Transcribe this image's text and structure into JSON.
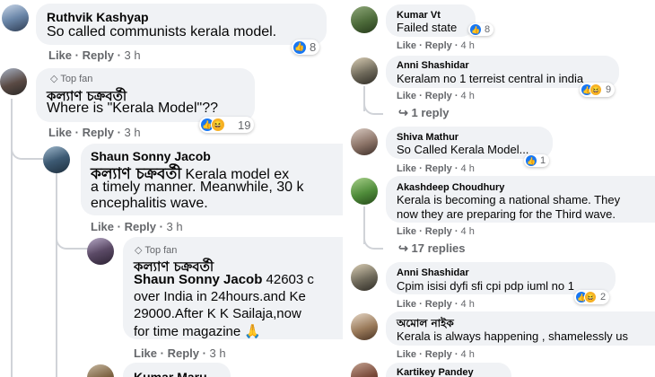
{
  "left": {
    "c1": {
      "name": "Ruthvik Kashyap",
      "text": "So called communists kerala model.",
      "like": "Like",
      "reply": "Reply",
      "time": "3 h",
      "count": "8"
    },
    "c2": {
      "badge": "Top fan",
      "name": "কল্যাণ চক্রবর্তী",
      "text": "Where is \"Kerala Model\"??",
      "like": "Like",
      "reply": "Reply",
      "time": "3 h",
      "count": "19"
    },
    "c3": {
      "name": "Shaun Sonny Jacob",
      "mention": "কল্যাণ চক্রবর্তী",
      "line1": "Kerala model ex",
      "line2": "a timely manner. Meanwhile, 30 k",
      "line3": "encephalitis wave.",
      "like": "Like",
      "reply": "Reply",
      "time": "3 h"
    },
    "c4": {
      "badge": "Top fan",
      "name": "কল্যাণ চক্রবর্তী",
      "mention": "Shaun Sonny Jacob",
      "line1": "42603 c",
      "line2": "over India in 24hours.and Ke",
      "line3": "29000.After K K Sailaja,now",
      "line4": "for time magazine",
      "like": "Like",
      "reply": "Reply",
      "time": "3 h"
    },
    "c5": {
      "name": "Kumar Maru"
    }
  },
  "right": {
    "c1": {
      "name": "Kumar Vt",
      "text": "Failed state",
      "like": "Like",
      "reply": "Reply",
      "time": "4 h",
      "count": "8"
    },
    "c2": {
      "name": "Anni Shashidar",
      "text": "Keralam no 1 terreist central in india",
      "like": "Like",
      "reply": "Reply",
      "time": "4 h",
      "count": "9",
      "replies": "1 reply"
    },
    "c3": {
      "name": "Shiva Mathur",
      "text": "So Called Kerala Model...",
      "like": "Like",
      "reply": "Reply",
      "time": "4 h",
      "count": "1"
    },
    "c4": {
      "name": "Akashdeep Choudhury",
      "line1": "Kerala is becoming a national shame. They",
      "line2": "now they are preparing for the Third wave.",
      "like": "Like",
      "reply": "Reply",
      "time": "4 h",
      "replies": "17 replies"
    },
    "c5": {
      "name": "Anni Shashidar",
      "text": "Cpim isisi dyfi sfi cpi pdp iuml no 1",
      "like": "Like",
      "reply": "Reply",
      "time": "4 h",
      "count": "2"
    },
    "c6": {
      "name": "অমোল নাইক",
      "text": "Kerala is always happening , shamelessly us",
      "like": "Like",
      "reply": "Reply",
      "time": "4 h"
    },
    "c7": {
      "name": "Kartikey Pandey"
    }
  }
}
